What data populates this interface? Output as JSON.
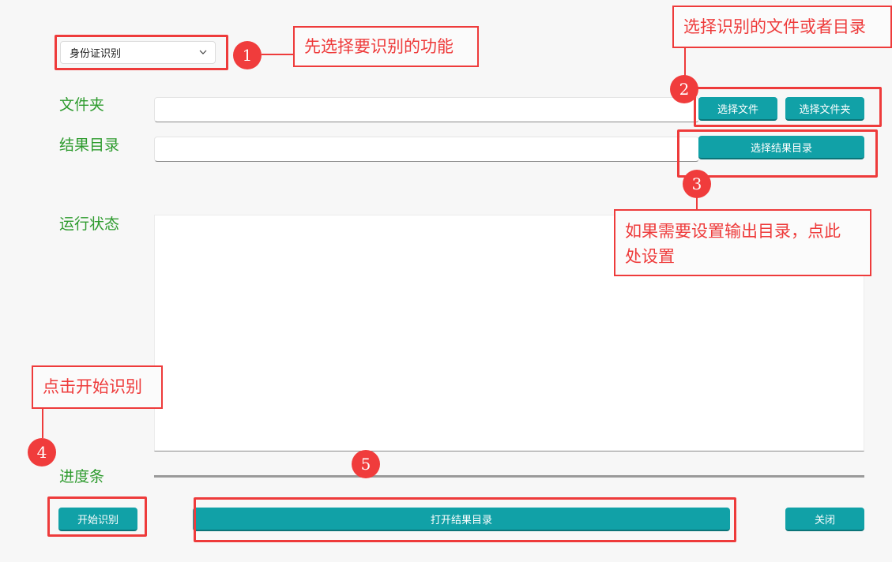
{
  "function_select": {
    "value": "身份证识别"
  },
  "form": {
    "folder_label": "文件夹",
    "result_dir_label": "结果目录",
    "status_label": "运行状态",
    "progress_label": "进度条",
    "progress_value": 0
  },
  "buttons": {
    "select_file": "选择文件",
    "select_folder": "选择文件夹",
    "select_result_dir": "选择结果目录",
    "start": "开始识别",
    "open_result_dir": "打开结果目录",
    "close": "关闭"
  },
  "annotations": {
    "step1_text": "先选择要识别的功能",
    "step2_text": "选择识别的文件或者目录",
    "step3_text_line1": "如果需要设置输出目录，点此",
    "step3_text_line2": "处设置",
    "step4_text": "点击开始识别",
    "badges": [
      "1",
      "2",
      "3",
      "4",
      "5"
    ]
  },
  "colors": {
    "accent": "#11a1a7",
    "label_green": "#2e9b2e",
    "annotation_red": "#ee3b3b"
  }
}
